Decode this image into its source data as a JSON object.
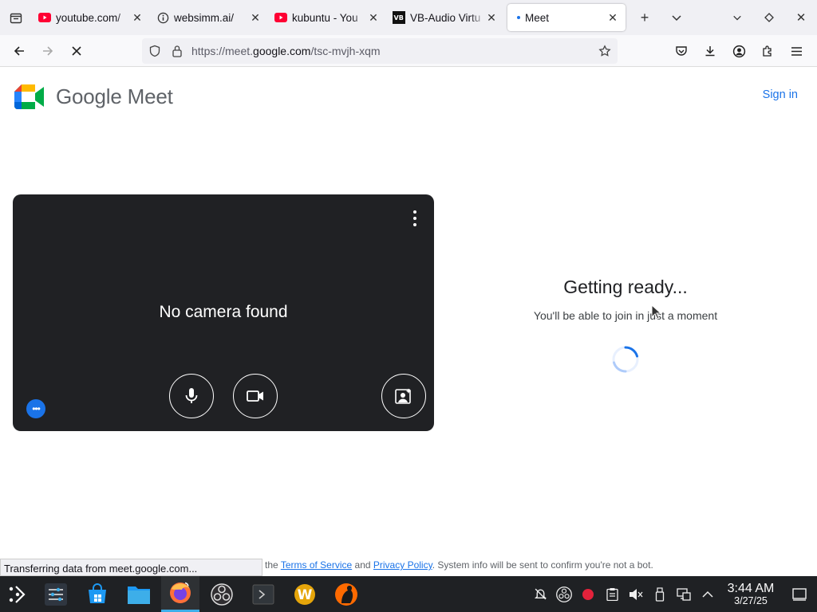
{
  "tabs": [
    {
      "title": "youtube.com/",
      "favicon": "youtube-icon"
    },
    {
      "title": "websimm.ai/",
      "favicon": "info-icon"
    },
    {
      "title": "kubuntu - You",
      "favicon": "youtube-icon"
    },
    {
      "title": "VB-Audio Virtu",
      "favicon": "vb-audio-icon"
    },
    {
      "title": "Meet",
      "favicon": "loading-dot",
      "active": true
    }
  ],
  "url": {
    "prefix": "https://meet.",
    "domain": "google.com",
    "path": "/tsc-mvjh-xqm"
  },
  "header": {
    "logo_text": "Google Meet",
    "sign_in": "Sign in"
  },
  "preview": {
    "message": "No camera found"
  },
  "status": {
    "heading": "Getting ready...",
    "sub": "You'll be able to join in just a moment"
  },
  "legal": {
    "prefix": "the",
    "tos": "Terms of Service",
    "and": "and",
    "privacy": "Privacy Policy",
    "suffix": ". System info will be sent to confirm you're not a bot."
  },
  "statusbar": {
    "text": "Transferring data from meet.google.com..."
  },
  "clock": {
    "time": "3:44 AM",
    "date": "3/27/25"
  },
  "colors": {
    "accent": "#1a73e8",
    "preview_bg": "#202124",
    "taskbar": "#1f2124"
  }
}
